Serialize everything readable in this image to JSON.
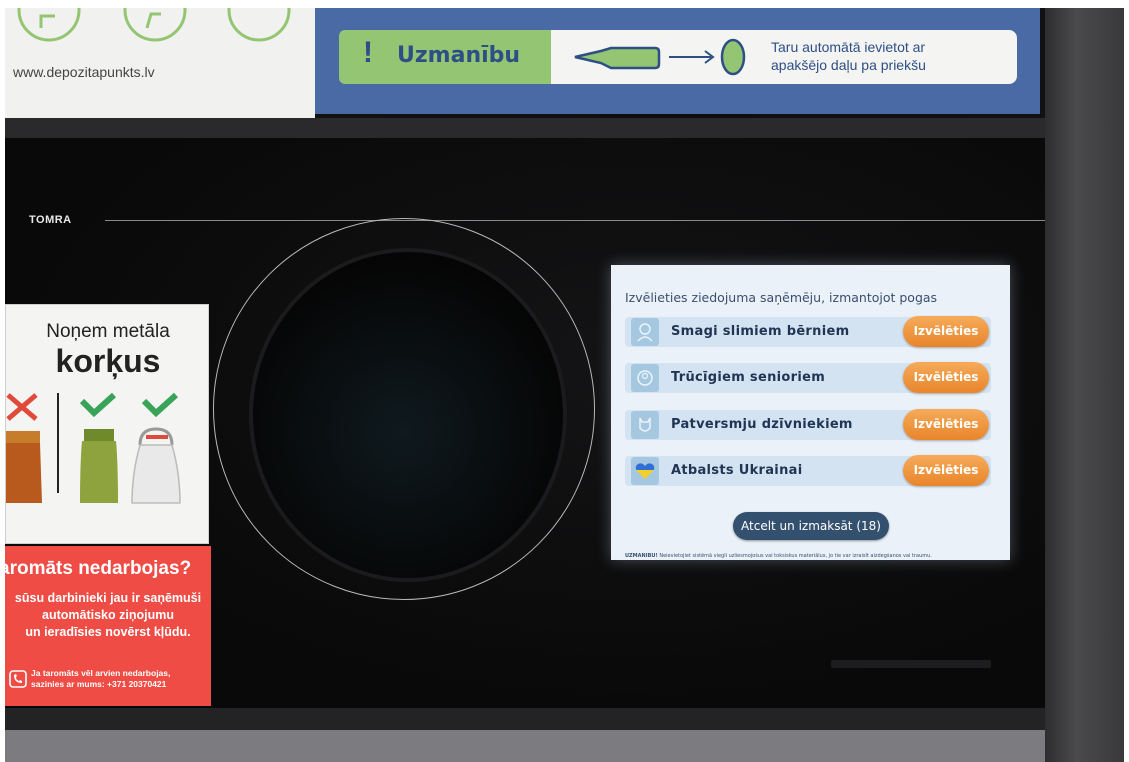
{
  "header_sticker": {
    "url": "www.depozitapunkts.lv",
    "warning_label": "Uzmanību",
    "warning_mark": "!",
    "instruction_line1": "Taru automātā ievietot ar",
    "instruction_line2": "apakšējo daļu pa priekšu",
    "accent_green": "#93c572",
    "panel_blue": "#4a6aa6"
  },
  "machine": {
    "brand": "TOMRA"
  },
  "cap_sticker": {
    "title_line1": "Noņem metāla",
    "title_line2": "korķus",
    "icons": [
      "cross-icon",
      "check-icon",
      "check-icon"
    ]
  },
  "help_sticker": {
    "title": "aromāts nedarbojas?",
    "body_lines": [
      "sūsu darbinieki jau ir saņēmuši",
      "automātisko ziņojumu",
      "un ieradīsies novērst kļūdu."
    ],
    "footer_line1": "Ja taromāts vēl arvien nedarbojas,",
    "footer_line2": "sazinies ar mums: +371 20370421",
    "background": "#ef4c45"
  },
  "screen": {
    "prompt": "Izvēlieties ziedojuma saņēmēju, izmantojot pogas",
    "options": [
      {
        "label": "Smagi slimiem bērniem",
        "button": "Izvēlēties",
        "icon": "child-icon"
      },
      {
        "label": "Trūcīgiem senioriem",
        "button": "Izvēlēties",
        "icon": "elder-icon"
      },
      {
        "label": "Patversmju dzīvniekiem",
        "button": "Izvēlēties",
        "icon": "animal-icon"
      },
      {
        "label": "Atbalsts Ukrainai",
        "button": "Izvēlēties",
        "icon": "heart-ukraine-icon"
      }
    ],
    "cancel_label": "Atcelt un izmaksāt (18)",
    "warning_bold": "UZMANĪBU!",
    "warning_text": " Neievietojiet sistēmā viegli uzliesmojošus vai toksiskus materiālus, jo tie var izraisīt aizdegšanos vai traumu.",
    "button_color": "#e8852b",
    "cancel_color": "#34506f"
  }
}
